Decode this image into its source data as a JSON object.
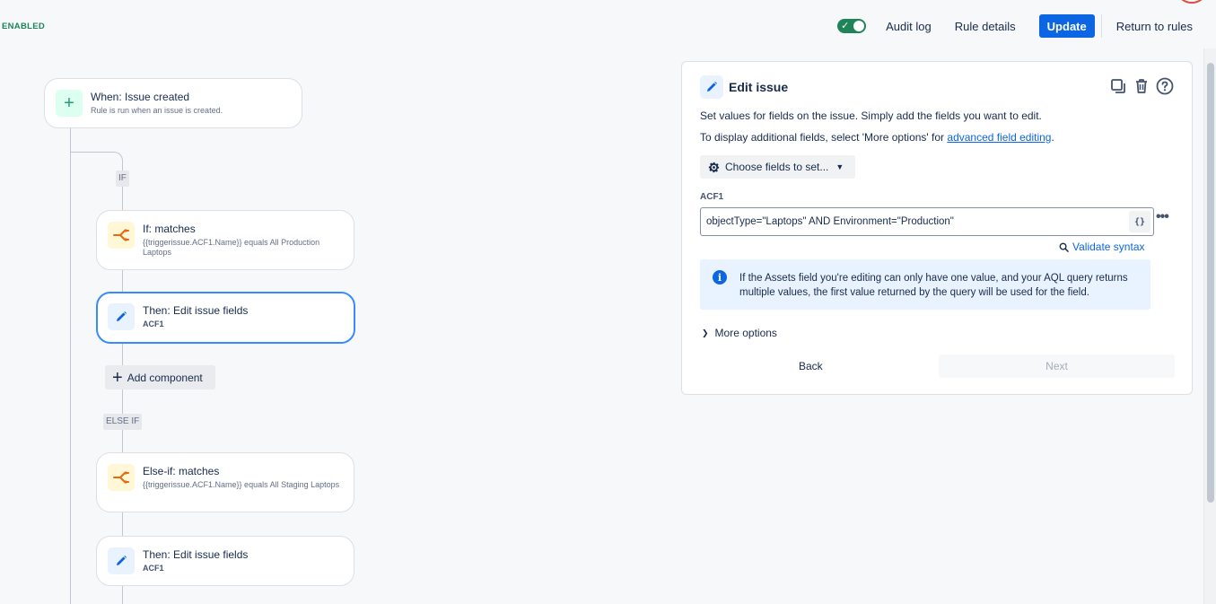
{
  "status": {
    "enabled_label": "ENABLED"
  },
  "topbar": {
    "toggle_state": "on",
    "audit_log": "Audit log",
    "rule_details": "Rule details",
    "update": "Update",
    "return_to_rules": "Return to rules"
  },
  "flow": {
    "trigger": {
      "title": "When: Issue created",
      "subtitle": "Rule is run when an issue is created."
    },
    "if_tag": "IF",
    "if_node": {
      "title": "If: matches",
      "subtitle": "{{triggerissue.ACF1.Name}} equals All Production Laptops"
    },
    "then_node_1": {
      "title": "Then: Edit issue fields",
      "subtitle": "ACF1"
    },
    "add_component": "Add component",
    "else_if_tag": "ELSE IF",
    "else_if_node": {
      "title": "Else-if: matches",
      "subtitle": "{{triggerissue.ACF1.Name}} equals All Staging Laptops"
    },
    "then_node_2": {
      "title": "Then: Edit issue fields",
      "subtitle": "ACF1"
    }
  },
  "panel": {
    "title": "Edit issue",
    "desc_1": "Set values for fields on the issue. Simply add the fields you want to edit.",
    "desc_2_prefix": "To display additional fields, select 'More options' for ",
    "desc_2_link": "advanced field editing",
    "desc_2_suffix": ".",
    "choose_fields": "Choose fields to set...",
    "field_label": "ACF1",
    "field_value": "objectType=\"Laptops\" AND Environment=\"Production\"",
    "smart_values": "{}",
    "validate": "Validate syntax",
    "info": "If the Assets field you're editing can only have one value, and your AQL query returns multiple values, the first value returned by the query will be used for the field.",
    "more_options": "More options",
    "back": "Back",
    "next": "Next"
  },
  "colors": {
    "primary": "#0c66e4",
    "success": "#1f845a",
    "selected_border": "#388bff"
  }
}
